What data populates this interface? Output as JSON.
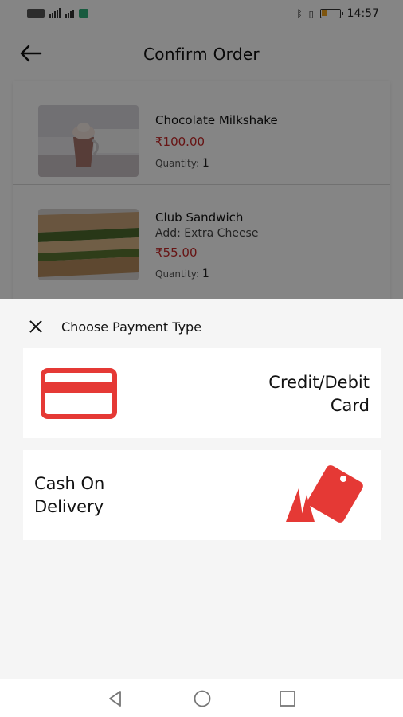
{
  "status_bar": {
    "time": "14:57"
  },
  "header": {
    "title": "Confirm Order"
  },
  "order": {
    "items": [
      {
        "name": "Chocolate Milkshake",
        "addon": "",
        "price": "₹100.00",
        "quantity_label": "Quantity:",
        "quantity": "1"
      },
      {
        "name": "Club Sandwich",
        "addon": "Add: Extra Cheese",
        "price": "₹55.00",
        "quantity_label": "Quantity:",
        "quantity": "1"
      }
    ]
  },
  "payment_sheet": {
    "title": "Choose Payment Type",
    "options": [
      {
        "label_line1": "Credit/Debit",
        "label_line2": "Card",
        "icon": "credit-card-icon"
      },
      {
        "label_line1": "Cash On",
        "label_line2": "Delivery",
        "icon": "cash-tag-icon"
      }
    ]
  },
  "colors": {
    "accent": "#e53935",
    "price": "#c62828",
    "overlay": "rgba(0,0,0,0.48)"
  },
  "nav_bar": {
    "buttons": [
      "back-triangle-icon",
      "home-circle-icon",
      "recents-square-icon"
    ]
  }
}
